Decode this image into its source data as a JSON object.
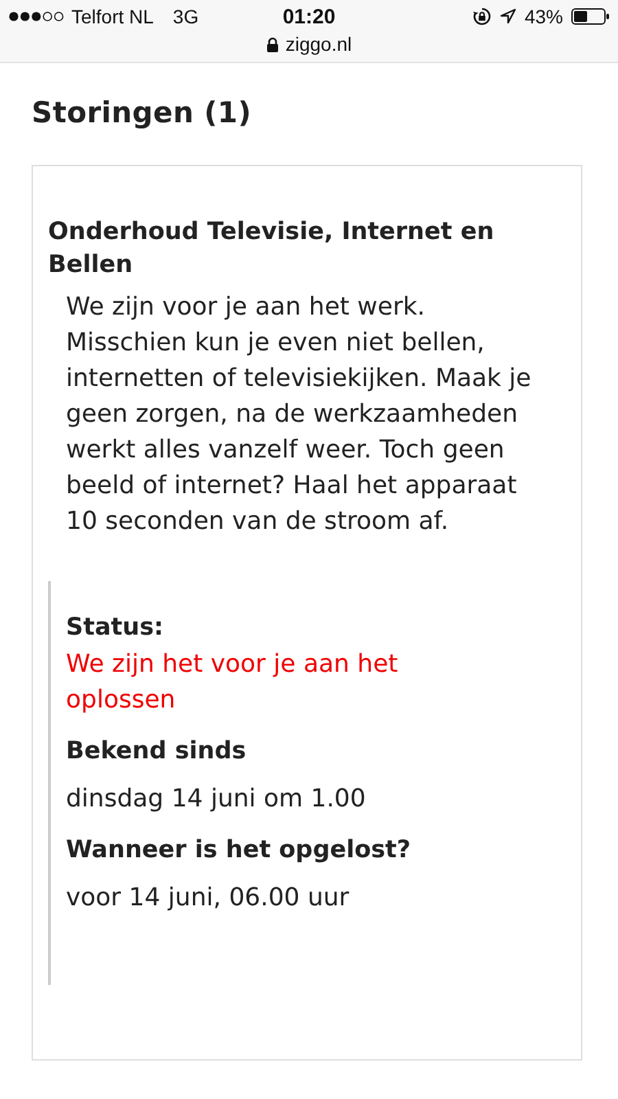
{
  "status_bar": {
    "carrier": "Telfort NL",
    "network": "3G",
    "time": "01:20",
    "battery": "43%"
  },
  "address_bar": {
    "url": "ziggo.nl"
  },
  "heading": "Storingen (1)",
  "outage": {
    "title": "Onderhoud Televisie, Internet en Bellen",
    "description": "We zijn voor je aan het werk. Misschien kun je even niet bellen, internetten of televisiekijken. Maak je geen zorgen, na de werkzaamheden werkt alles vanzelf weer. Toch geen beeld of internet? Haal het apparaat 10 seconden van de stroom af.",
    "details": [
      {
        "label": "Status:",
        "value": "We zijn het voor je aan het oplossen",
        "kind": "alert"
      },
      {
        "label": "Bekend sinds",
        "value": "dinsdag 14 juni om 1.00",
        "kind": "plain"
      },
      {
        "label": "Wanneer is het opgelost?",
        "value": "voor 14 juni, 06.00 uur",
        "kind": "plain"
      }
    ]
  }
}
